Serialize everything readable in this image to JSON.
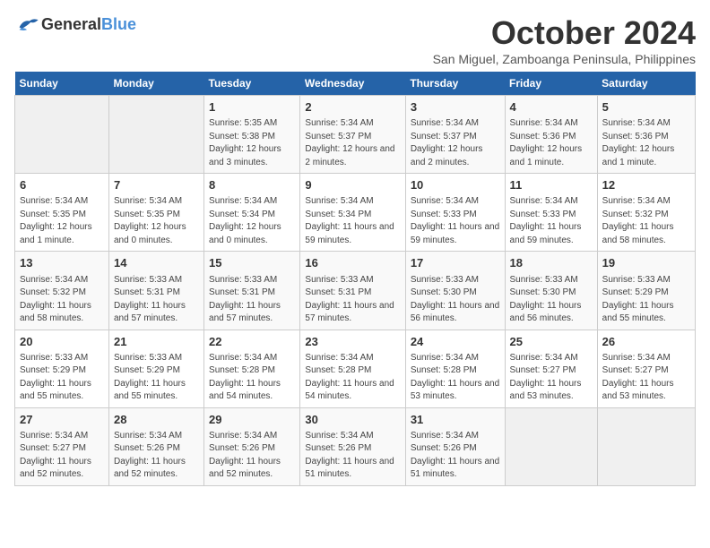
{
  "header": {
    "logo_general": "General",
    "logo_blue": "Blue",
    "month_title": "October 2024",
    "subtitle": "San Miguel, Zamboanga Peninsula, Philippines"
  },
  "weekdays": [
    "Sunday",
    "Monday",
    "Tuesday",
    "Wednesday",
    "Thursday",
    "Friday",
    "Saturday"
  ],
  "weeks": [
    [
      {
        "day": "",
        "content": ""
      },
      {
        "day": "",
        "content": ""
      },
      {
        "day": "1",
        "content": "Sunrise: 5:35 AM\nSunset: 5:38 PM\nDaylight: 12 hours and 3 minutes."
      },
      {
        "day": "2",
        "content": "Sunrise: 5:34 AM\nSunset: 5:37 PM\nDaylight: 12 hours and 2 minutes."
      },
      {
        "day": "3",
        "content": "Sunrise: 5:34 AM\nSunset: 5:37 PM\nDaylight: 12 hours and 2 minutes."
      },
      {
        "day": "4",
        "content": "Sunrise: 5:34 AM\nSunset: 5:36 PM\nDaylight: 12 hours and 1 minute."
      },
      {
        "day": "5",
        "content": "Sunrise: 5:34 AM\nSunset: 5:36 PM\nDaylight: 12 hours and 1 minute."
      }
    ],
    [
      {
        "day": "6",
        "content": "Sunrise: 5:34 AM\nSunset: 5:35 PM\nDaylight: 12 hours and 1 minute."
      },
      {
        "day": "7",
        "content": "Sunrise: 5:34 AM\nSunset: 5:35 PM\nDaylight: 12 hours and 0 minutes."
      },
      {
        "day": "8",
        "content": "Sunrise: 5:34 AM\nSunset: 5:34 PM\nDaylight: 12 hours and 0 minutes."
      },
      {
        "day": "9",
        "content": "Sunrise: 5:34 AM\nSunset: 5:34 PM\nDaylight: 11 hours and 59 minutes."
      },
      {
        "day": "10",
        "content": "Sunrise: 5:34 AM\nSunset: 5:33 PM\nDaylight: 11 hours and 59 minutes."
      },
      {
        "day": "11",
        "content": "Sunrise: 5:34 AM\nSunset: 5:33 PM\nDaylight: 11 hours and 59 minutes."
      },
      {
        "day": "12",
        "content": "Sunrise: 5:34 AM\nSunset: 5:32 PM\nDaylight: 11 hours and 58 minutes."
      }
    ],
    [
      {
        "day": "13",
        "content": "Sunrise: 5:34 AM\nSunset: 5:32 PM\nDaylight: 11 hours and 58 minutes."
      },
      {
        "day": "14",
        "content": "Sunrise: 5:33 AM\nSunset: 5:31 PM\nDaylight: 11 hours and 57 minutes."
      },
      {
        "day": "15",
        "content": "Sunrise: 5:33 AM\nSunset: 5:31 PM\nDaylight: 11 hours and 57 minutes."
      },
      {
        "day": "16",
        "content": "Sunrise: 5:33 AM\nSunset: 5:31 PM\nDaylight: 11 hours and 57 minutes."
      },
      {
        "day": "17",
        "content": "Sunrise: 5:33 AM\nSunset: 5:30 PM\nDaylight: 11 hours and 56 minutes."
      },
      {
        "day": "18",
        "content": "Sunrise: 5:33 AM\nSunset: 5:30 PM\nDaylight: 11 hours and 56 minutes."
      },
      {
        "day": "19",
        "content": "Sunrise: 5:33 AM\nSunset: 5:29 PM\nDaylight: 11 hours and 55 minutes."
      }
    ],
    [
      {
        "day": "20",
        "content": "Sunrise: 5:33 AM\nSunset: 5:29 PM\nDaylight: 11 hours and 55 minutes."
      },
      {
        "day": "21",
        "content": "Sunrise: 5:33 AM\nSunset: 5:29 PM\nDaylight: 11 hours and 55 minutes."
      },
      {
        "day": "22",
        "content": "Sunrise: 5:34 AM\nSunset: 5:28 PM\nDaylight: 11 hours and 54 minutes."
      },
      {
        "day": "23",
        "content": "Sunrise: 5:34 AM\nSunset: 5:28 PM\nDaylight: 11 hours and 54 minutes."
      },
      {
        "day": "24",
        "content": "Sunrise: 5:34 AM\nSunset: 5:28 PM\nDaylight: 11 hours and 53 minutes."
      },
      {
        "day": "25",
        "content": "Sunrise: 5:34 AM\nSunset: 5:27 PM\nDaylight: 11 hours and 53 minutes."
      },
      {
        "day": "26",
        "content": "Sunrise: 5:34 AM\nSunset: 5:27 PM\nDaylight: 11 hours and 53 minutes."
      }
    ],
    [
      {
        "day": "27",
        "content": "Sunrise: 5:34 AM\nSunset: 5:27 PM\nDaylight: 11 hours and 52 minutes."
      },
      {
        "day": "28",
        "content": "Sunrise: 5:34 AM\nSunset: 5:26 PM\nDaylight: 11 hours and 52 minutes."
      },
      {
        "day": "29",
        "content": "Sunrise: 5:34 AM\nSunset: 5:26 PM\nDaylight: 11 hours and 52 minutes."
      },
      {
        "day": "30",
        "content": "Sunrise: 5:34 AM\nSunset: 5:26 PM\nDaylight: 11 hours and 51 minutes."
      },
      {
        "day": "31",
        "content": "Sunrise: 5:34 AM\nSunset: 5:26 PM\nDaylight: 11 hours and 51 minutes."
      },
      {
        "day": "",
        "content": ""
      },
      {
        "day": "",
        "content": ""
      }
    ]
  ]
}
